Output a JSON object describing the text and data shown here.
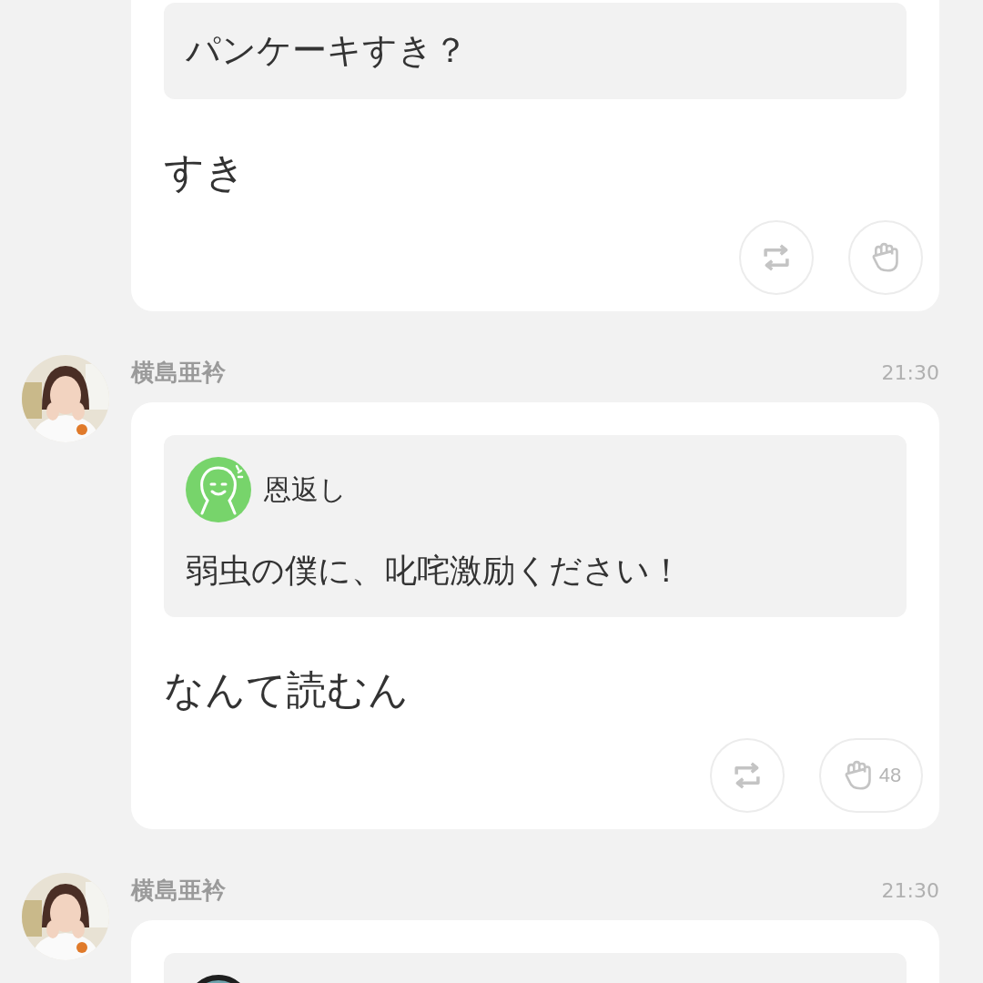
{
  "posts": [
    {
      "question": {
        "text": "パンケーキすき？"
      },
      "answer": "すき",
      "actions": [
        {
          "kind": "repost"
        },
        {
          "kind": "clap"
        }
      ]
    },
    {
      "author": "横島亜衿",
      "time": "21:30",
      "question": {
        "asker": {
          "kind": "smile",
          "name": "恩返し"
        },
        "text": "弱虫の僕に、叱咤激励ください！"
      },
      "answer": "なんて読むん",
      "actions": [
        {
          "kind": "repost"
        },
        {
          "kind": "clap",
          "count": "48"
        }
      ]
    },
    {
      "author": "横島亜衿",
      "time": "21:30"
    }
  ]
}
